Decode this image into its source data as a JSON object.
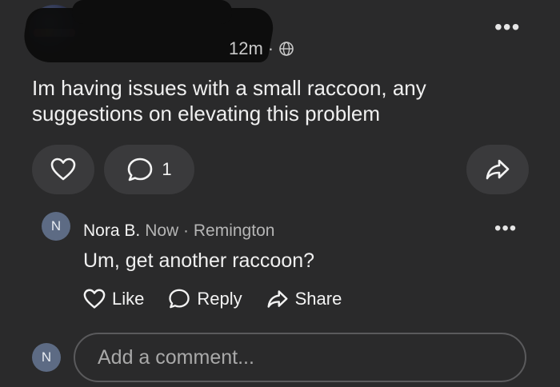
{
  "post": {
    "time": "12m",
    "separator": "·",
    "body": "Im having issues with a small raccoon,  any suggestions on elevating this problem",
    "comment_count": "1",
    "more_label": "•••"
  },
  "comment": {
    "avatar_initial": "N",
    "author": "Nora B.",
    "meta": "Now · Remington",
    "text": "Um, get another raccoon?",
    "more_label": "•••",
    "actions": {
      "like": "Like",
      "reply": "Reply",
      "share": "Share"
    }
  },
  "composer": {
    "avatar_initial": "N",
    "placeholder": "Add a comment..."
  },
  "colors": {
    "background": "#2a2a2b",
    "pill": "#3a3a3c",
    "avatar": "#5d6b84"
  }
}
